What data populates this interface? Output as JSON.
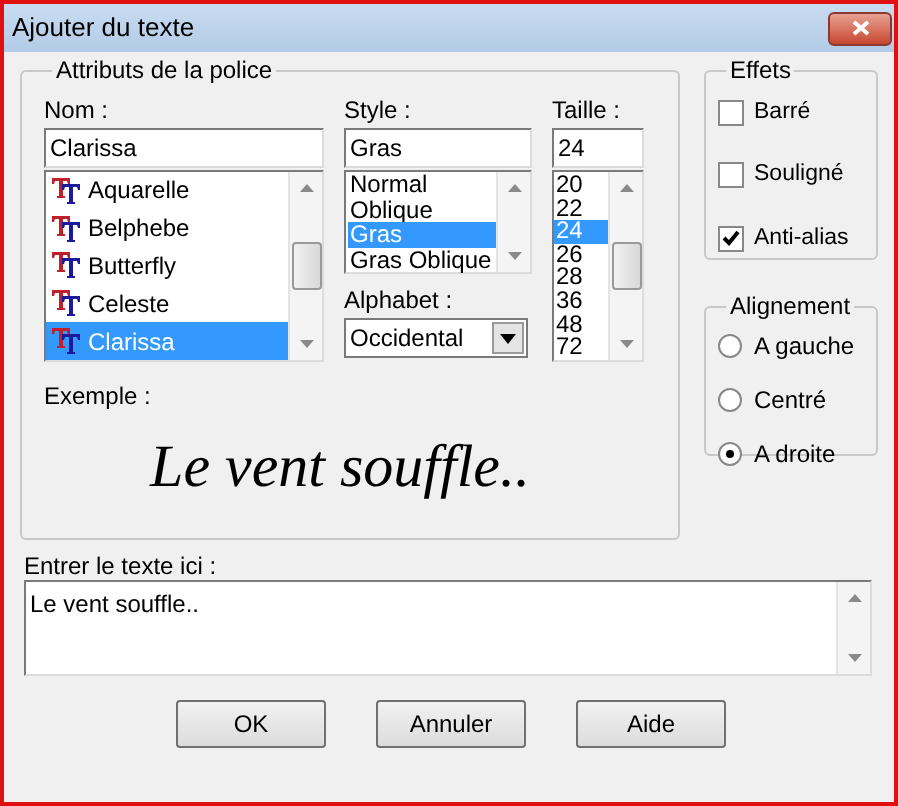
{
  "window": {
    "title": "Ajouter du texte"
  },
  "font_attributes": {
    "title": "Attributs de la police",
    "name": {
      "label": "Nom :",
      "value": "Clarissa",
      "items": [
        {
          "label": "Aquarelle",
          "selected": false
        },
        {
          "label": "Belphebe",
          "selected": false
        },
        {
          "label": "Butterfly",
          "selected": false
        },
        {
          "label": "Celeste",
          "selected": false
        },
        {
          "label": "Clarissa",
          "selected": true
        }
      ]
    },
    "style": {
      "label": "Style :",
      "value": "Gras",
      "items": [
        {
          "label": "Normal",
          "selected": false
        },
        {
          "label": "Oblique",
          "selected": false
        },
        {
          "label": "Gras",
          "selected": true
        },
        {
          "label": "Gras Oblique",
          "selected": false
        }
      ]
    },
    "size": {
      "label": "Taille :",
      "value": "24",
      "items": [
        {
          "label": "20",
          "selected": false
        },
        {
          "label": "22",
          "selected": false
        },
        {
          "label": "24",
          "selected": true
        },
        {
          "label": "26",
          "selected": false
        },
        {
          "label": "28",
          "selected": false
        },
        {
          "label": "36",
          "selected": false
        },
        {
          "label": "48",
          "selected": false
        },
        {
          "label": "72",
          "selected": false
        }
      ]
    },
    "alphabet": {
      "label": "Alphabet :",
      "value": "Occidental"
    },
    "example": {
      "label": "Exemple :",
      "text": "Le vent souffle.."
    }
  },
  "effects": {
    "title": "Effets",
    "items": [
      {
        "label": "Barré",
        "checked": false
      },
      {
        "label": "Souligné",
        "checked": false
      },
      {
        "label": "Anti-alias",
        "checked": true
      }
    ]
  },
  "alignment": {
    "title": "Alignement",
    "options": [
      {
        "label": "A gauche",
        "selected": false
      },
      {
        "label": "Centré",
        "selected": false
      },
      {
        "label": "A droite",
        "selected": true
      }
    ]
  },
  "text_entry": {
    "label": "Entrer le texte ici :",
    "value": "Le vent souffle.."
  },
  "buttons": [
    "OK",
    "Annuler",
    "Aide"
  ]
}
